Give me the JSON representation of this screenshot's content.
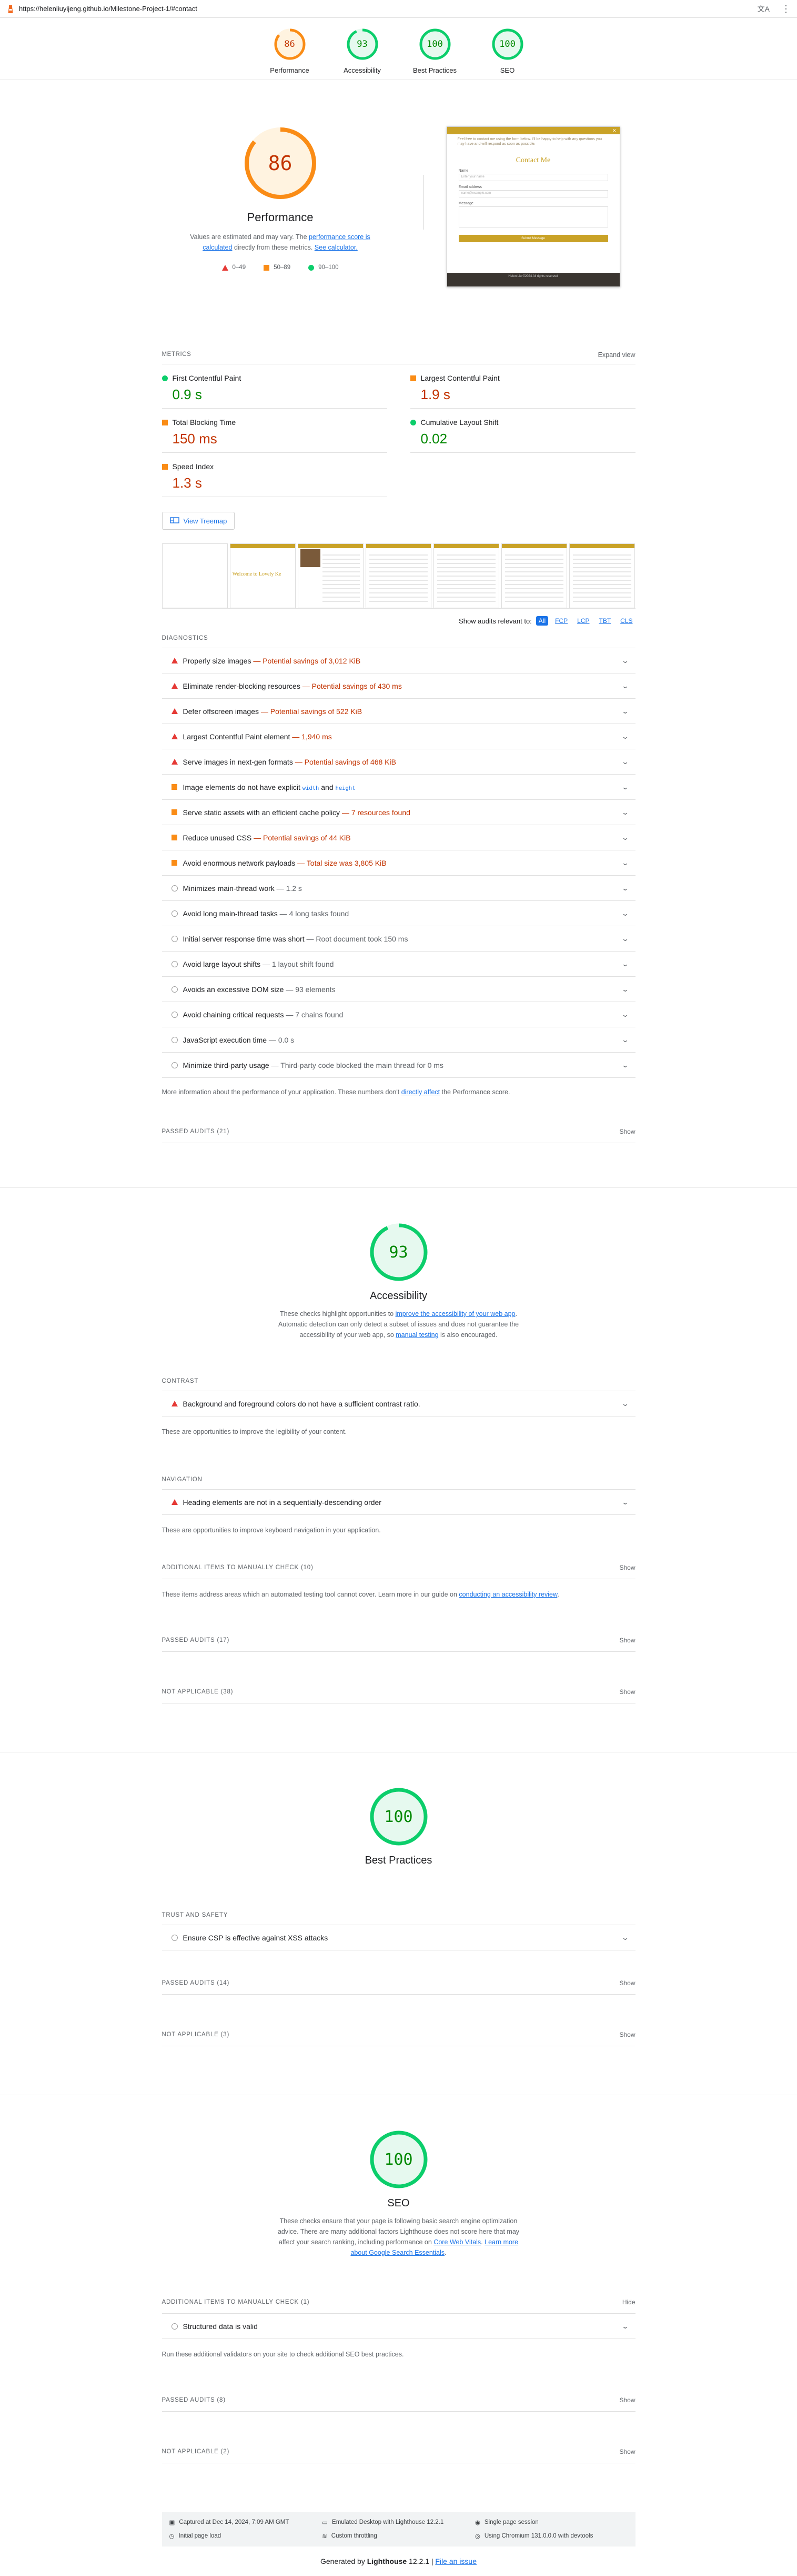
{
  "topbar": {
    "url": "https://helenliuyijeng.github.io/Milestone-Project-1/#contact"
  },
  "gauges": [
    {
      "label": "Performance",
      "score": "86",
      "color": "#fa8c16"
    },
    {
      "label": "Accessibility",
      "score": "93",
      "color": "#0cce6b"
    },
    {
      "label": "Best Practices",
      "score": "100",
      "color": "#0cce6b"
    },
    {
      "label": "SEO",
      "score": "100",
      "color": "#0cce6b"
    }
  ],
  "performance": {
    "score": "86",
    "title": "Performance",
    "desc_1": "Values are estimated and may vary. The ",
    "desc_link1": "performance score is calculated",
    "desc_2": " directly from these metrics. ",
    "desc_link2": "See calculator.",
    "legend": [
      "0–49",
      "50–89",
      "90–100"
    ],
    "metrics_label": "METRICS",
    "expand_label": "Expand view",
    "metrics": [
      {
        "name": "First Contentful Paint",
        "value": "0.9 s",
        "status": "pass"
      },
      {
        "name": "Largest Contentful Paint",
        "value": "1.9 s",
        "status": "average"
      },
      {
        "name": "Total Blocking Time",
        "value": "150 ms",
        "status": "average"
      },
      {
        "name": "Cumulative Layout Shift",
        "value": "0.02",
        "status": "pass"
      },
      {
        "name": "Speed Index",
        "value": "1.3 s",
        "status": "average"
      }
    ],
    "treemap_label": "View Treemap",
    "shot": {
      "heading": "Contact Me",
      "intro": "Feel free to contact me using the form below. I'll be happy to help with any questions you may have and will respond as soon as possible.",
      "f1": "Name",
      "f1_ph": "Enter your name",
      "f2": "Email address",
      "f2_ph": "name@example.com",
      "f3": "Message",
      "button": "Submit Message",
      "footer": "Helen Liu ©2024 All rights reserved"
    },
    "film_heading": "Welcome to Lovely Ke",
    "relevant_label": "Show audits relevant to:",
    "relevant_tags": [
      "All",
      "FCP",
      "LCP",
      "TBT",
      "CLS"
    ],
    "diag_label": "DIAGNOSTICS",
    "audits": [
      {
        "title": "Properly size images",
        "detail": "Potential savings of 3,012 KiB",
        "status": "fail"
      },
      {
        "title": "Eliminate render-blocking resources",
        "detail": "Potential savings of 430 ms",
        "status": "fail"
      },
      {
        "title": "Defer offscreen images",
        "detail": "Potential savings of 522 KiB",
        "status": "fail"
      },
      {
        "title": "Largest Contentful Paint element",
        "detail": "1,940 ms",
        "status": "fail"
      },
      {
        "title": "Serve images in next-gen formats",
        "detail": "Potential savings of 468 KiB",
        "status": "fail"
      },
      {
        "title": "Image elements do not have explicit ",
        "code1": "width",
        "mid": " and ",
        "code2": "height",
        "status": "average"
      },
      {
        "title": "Serve static assets with an efficient cache policy",
        "detail": "7 resources found",
        "status": "average"
      },
      {
        "title": "Reduce unused CSS",
        "detail": "Potential savings of 44 KiB",
        "status": "average"
      },
      {
        "title": "Avoid enormous network payloads",
        "detail": "Total size was 3,805 KiB",
        "status": "average"
      },
      {
        "title": "Minimizes main-thread work",
        "detail": "1.2 s",
        "status": "info"
      },
      {
        "title": "Avoid long main-thread tasks",
        "detail": "4 long tasks found",
        "status": "info"
      },
      {
        "title": "Initial server response time was short",
        "detail": "Root document took 150 ms",
        "status": "info"
      },
      {
        "title": "Avoid large layout shifts",
        "detail": "1 layout shift found",
        "status": "info"
      },
      {
        "title": "Avoids an excessive DOM size",
        "detail": "93 elements",
        "status": "info"
      },
      {
        "title": "Avoid chaining critical requests",
        "detail": "7 chains found",
        "status": "info"
      },
      {
        "title": "JavaScript execution time",
        "detail": "0.0 s",
        "status": "info"
      },
      {
        "title": "Minimize third-party usage",
        "detail": "Third-party code blocked the main thread for 0 ms",
        "status": "info"
      }
    ],
    "note_1": "More information about the performance of your application. These numbers don't ",
    "note_link": "directly affect",
    "note_2": " the Performance score.",
    "passed": "PASSED AUDITS (21)",
    "show": "Show"
  },
  "accessibility": {
    "score": "93",
    "title": "Accessibility",
    "desc_1": "These checks highlight opportunities to ",
    "desc_link1": "improve the accessibility of your web app",
    "desc_2": ". Automatic detection can only detect a subset of issues and does not guarantee the accessibility of your web app, so ",
    "desc_link2": "manual testing",
    "desc_3": " is also encouraged.",
    "contrast_label": "CONTRAST",
    "contrast_audit": "Background and foreground colors do not have a sufficient contrast ratio.",
    "contrast_note": "These are opportunities to improve the legibility of your content.",
    "nav_label": "NAVIGATION",
    "nav_audit": "Heading elements are not in a sequentially-descending order",
    "nav_note": "These are opportunities to improve keyboard navigation in your application.",
    "manual": "ADDITIONAL ITEMS TO MANUALLY CHECK (10)",
    "manual_note_1": "These items address areas which an automated testing tool cannot cover. Learn more in our guide on ",
    "manual_note_link": "conducting an accessibility review",
    "manual_note_2": ".",
    "passed": "PASSED AUDITS (17)",
    "na": "NOT APPLICABLE (38)",
    "show": "Show"
  },
  "best_practices": {
    "score": "100",
    "title": "Best Practices",
    "trust_label": "TRUST AND SAFETY",
    "trust_audit": "Ensure CSP is effective against XSS attacks",
    "passed": "PASSED AUDITS (14)",
    "na": "NOT APPLICABLE (3)",
    "show": "Show"
  },
  "seo": {
    "score": "100",
    "title": "SEO",
    "desc_1": "These checks ensure that your page is following basic search engine optimization advice. There are many additional factors Lighthouse does not score here that may affect your search ranking, including performance on ",
    "desc_link1": "Core Web Vitals",
    "desc_2": ". ",
    "desc_link2": "Learn more about Google Search Essentials",
    "desc_3": ".",
    "manual": "ADDITIONAL ITEMS TO MANUALLY CHECK (1)",
    "hide": "Hide",
    "manual_audit": "Structured data is valid",
    "manual_note": "Run these additional validators on your site to check additional SEO best practices.",
    "passed": "PASSED AUDITS (8)",
    "na": "NOT APPLICABLE (2)",
    "show": "Show"
  },
  "footer": {
    "items": [
      "Captured at Dec 14, 2024, 7:09 AM GMT",
      "Emulated Desktop with Lighthouse 12.2.1",
      "Single page session",
      "Initial page load",
      "Custom throttling",
      "Using Chromium 131.0.0.0 with devtools"
    ],
    "gen_1": "Generated by ",
    "gen_brand": "Lighthouse",
    "gen_ver": " 12.2.1 | ",
    "gen_link": "File an issue"
  },
  "colors": {
    "fail": "#e53935",
    "average": "#fa8c16",
    "pass": "#0cce6b",
    "link": "#1a73e8"
  }
}
